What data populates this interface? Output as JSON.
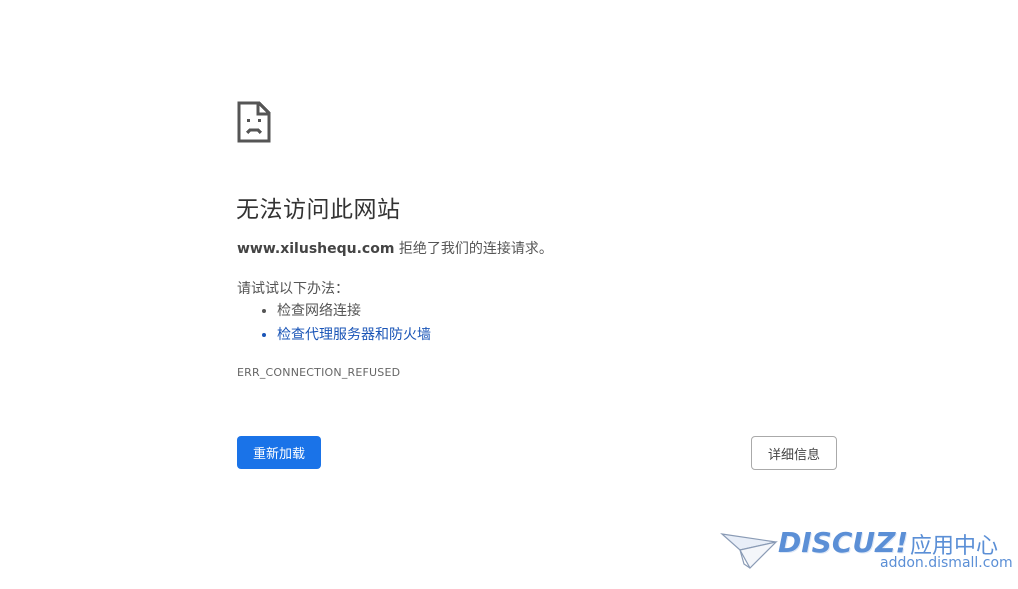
{
  "error": {
    "icon": "sad-page-icon",
    "heading": "无法访问此网站",
    "host": "www.xilushequ.com",
    "summary_suffix": " 拒绝了我们的连接请求。",
    "suggestions_title": "请试试以下办法：",
    "suggestions": [
      "检查网络连接",
      "检查代理服务器和防火墙"
    ],
    "code": "ERR_CONNECTION_REFUSED"
  },
  "buttons": {
    "reload": "重新加载",
    "details": "详细信息"
  },
  "watermark": {
    "logo": "DISCUZ!",
    "cn_label": "应用中心",
    "url": "addon.dismall.com",
    "icon": "paper-plane-icon"
  },
  "colors": {
    "primary": "#1a73e8",
    "link": "#1a55b7",
    "watermark": "#5b8fd6"
  }
}
